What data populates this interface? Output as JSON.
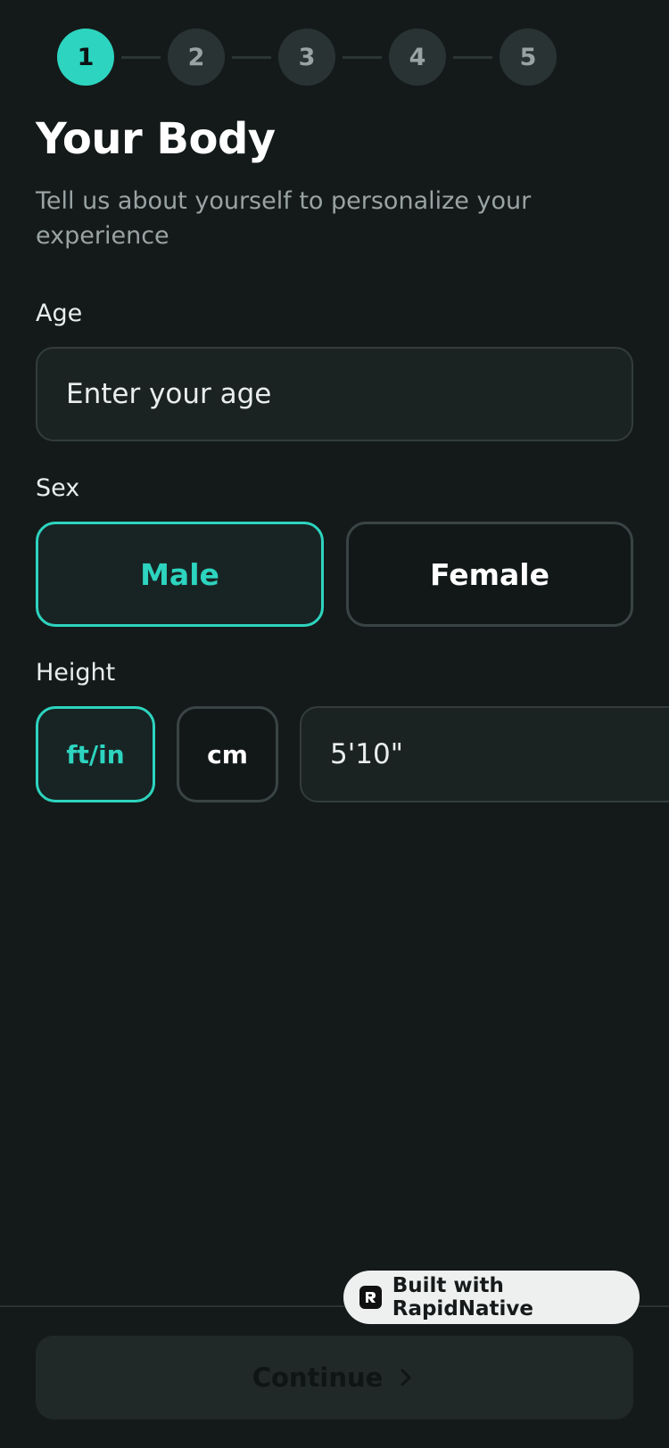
{
  "stepper": {
    "steps": [
      "1",
      "2",
      "3",
      "4",
      "5"
    ],
    "active_index": 0,
    "accent_color": "#2dd4bf"
  },
  "header": {
    "title": "Your Body",
    "subtitle": "Tell us about yourself to personalize your experience"
  },
  "age": {
    "label": "Age",
    "placeholder": "Enter your age",
    "value": ""
  },
  "sex": {
    "label": "Sex",
    "options": [
      "Male",
      "Female"
    ],
    "selected": "Male"
  },
  "height": {
    "label": "Height",
    "units": [
      "ft/in",
      "cm"
    ],
    "selected_unit": "ft/in",
    "value": "5'10\""
  },
  "footer": {
    "continue_label": "Continue",
    "continue_icon": "chevron-right-icon"
  },
  "badge": {
    "text": "Built with RapidNative",
    "icon": "rapidnative-logo-icon"
  }
}
